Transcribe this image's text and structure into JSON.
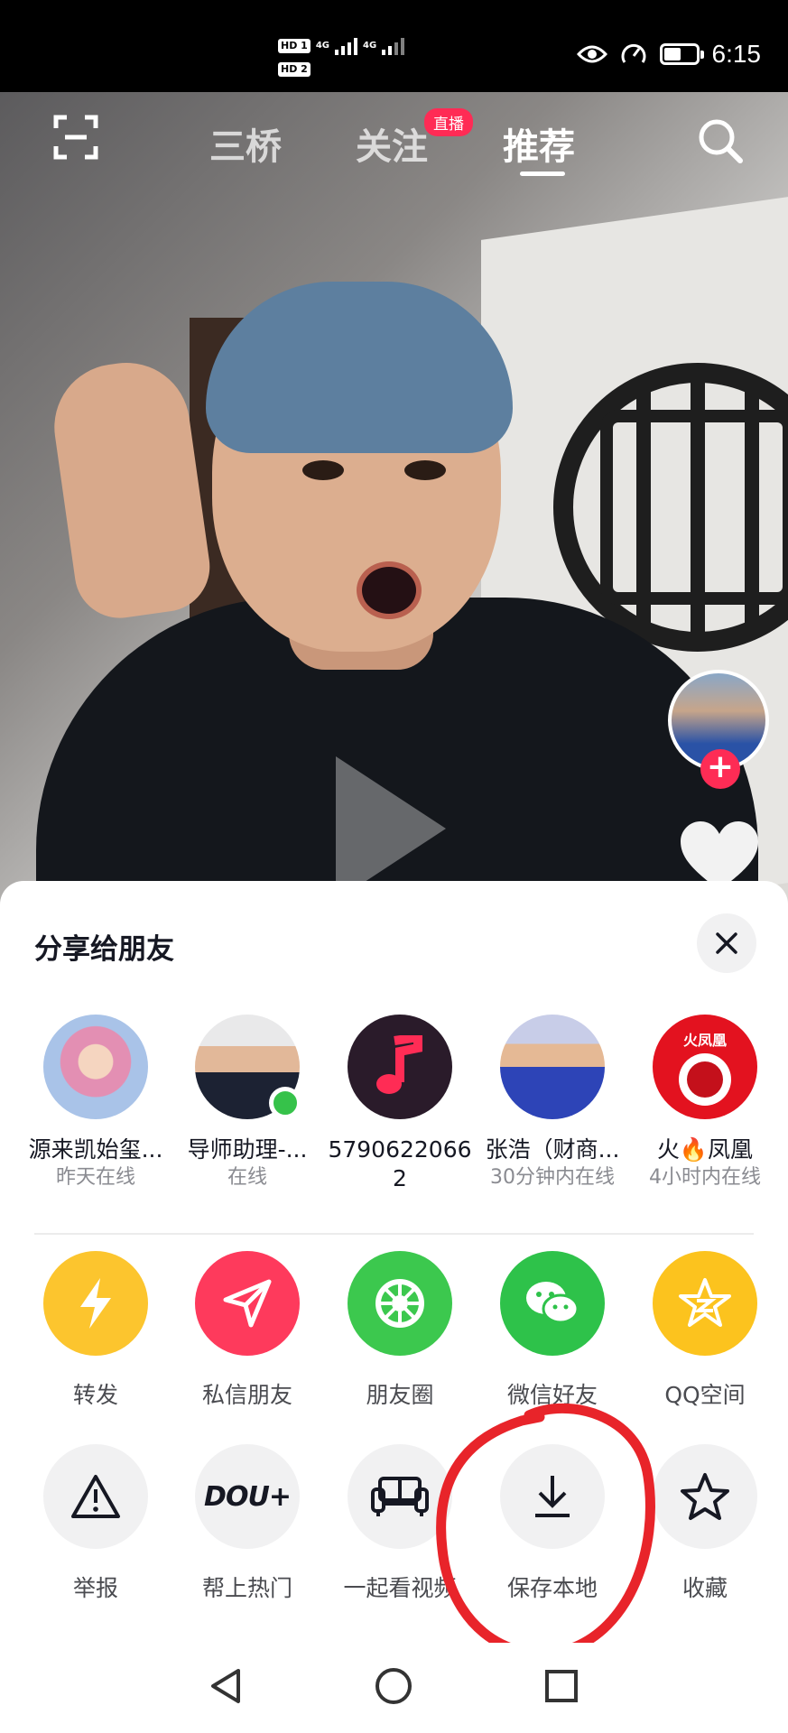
{
  "status_bar": {
    "sim1": "HD 1",
    "sim2": "HD 2",
    "net": "4G",
    "time": "6:15",
    "battery_level": 0.55
  },
  "topnav": {
    "tabs": [
      {
        "label": "三桥"
      },
      {
        "label": "关注"
      },
      {
        "label": "推荐"
      }
    ],
    "active_tab": "推荐",
    "live_badge": "直播"
  },
  "share_sheet": {
    "title": "分享给朋友",
    "friends": [
      {
        "name": "源来凯始玺...",
        "status": "昨天在线"
      },
      {
        "name": "导师助理-...",
        "status": "在线"
      },
      {
        "name": "5790622066",
        "name2": "2",
        "status": ""
      },
      {
        "name": "张浩（财商...",
        "status": "30分钟内在线"
      },
      {
        "name": "火🔥凤凰",
        "status": "4小时内在线",
        "badge": "火凤凰"
      }
    ],
    "share_actions": [
      {
        "label": "转发",
        "icon": "lightning-icon",
        "color": "#fcc52e"
      },
      {
        "label": "私信朋友",
        "icon": "send-icon",
        "color": "#fe3a5c"
      },
      {
        "label": "朋友圈",
        "icon": "wechat-moments-icon",
        "color": "#3cc84e"
      },
      {
        "label": "微信好友",
        "icon": "wechat-icon",
        "color": "#2ec24a"
      },
      {
        "label": "QQ空间",
        "icon": "qzone-icon",
        "color": "#fcc31e"
      }
    ],
    "tool_actions": [
      {
        "label": "举报",
        "icon": "warning-icon"
      },
      {
        "label": "帮上热门",
        "icon": "dou-plus-icon",
        "text": "DOU+"
      },
      {
        "label": "一起看视频",
        "icon": "sofa-icon"
      },
      {
        "label": "保存本地",
        "icon": "download-icon"
      },
      {
        "label": "收藏",
        "icon": "star-icon"
      }
    ]
  },
  "colors": {
    "accent": "#fe2c55",
    "annotation": "#e8242a"
  }
}
